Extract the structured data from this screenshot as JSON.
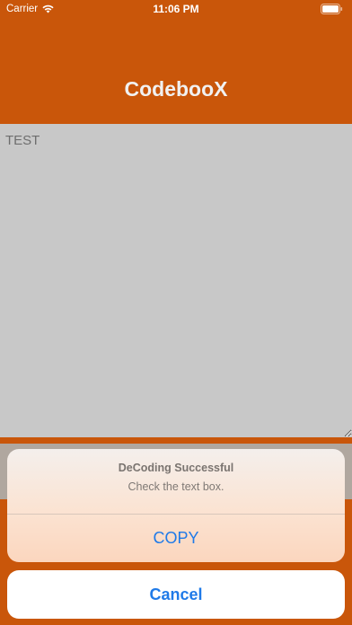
{
  "status_bar": {
    "carrier": "Carrier",
    "time": "11:06 PM",
    "wifi_icon": "wifi-icon",
    "battery_icon": "battery-icon"
  },
  "nav": {
    "title": "CodebooX"
  },
  "text_box": {
    "value": "TEST"
  },
  "action_sheet": {
    "title": "DeCoding Successful",
    "message": "Check the text box.",
    "copy_label": "COPY",
    "cancel_label": "Cancel"
  },
  "colors": {
    "accent": "#c9560a",
    "action_blue": "#1f7ae8",
    "text_box_bg": "#c8c8c8"
  }
}
